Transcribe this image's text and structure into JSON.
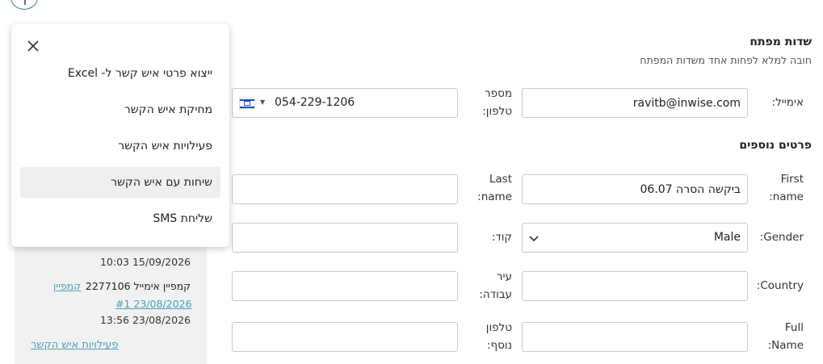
{
  "menu": {
    "items": [
      {
        "label": "ייצוא פרטי איש קשר ל- Excel"
      },
      {
        "label": "מחיקת איש הקשר"
      },
      {
        "label": "פעילויות איש הקשר"
      },
      {
        "label": "שיחות עם איש הקשר"
      },
      {
        "label": "שליחת SMS"
      }
    ]
  },
  "activity": {
    "items": [
      {
        "date": "10:03 15/09/2026"
      },
      {
        "text": "קמפיין אימייל 2277106",
        "link": "קמפיין #1 23/08/2026",
        "date": "13:56 23/08/2026"
      }
    ],
    "footer_link": "פעילויות איש הקשר"
  },
  "key_fields": {
    "title": "שדות מפתח",
    "subtitle": "חובה למלא לפחות אחד משדות המפתח",
    "email_label": "אימייל:",
    "email_value": "ravitb@inwise.com",
    "phone_label": "מספר טלפון:",
    "phone_value": "054-229-1206"
  },
  "extra_fields": {
    "title": "פרטים נוספים",
    "first_name_label": "First name:",
    "first_name_value": "ביקשה הסרה 06.07",
    "last_name_label": "Last name:",
    "last_name_value": "",
    "gender_label": "Gender:",
    "gender_value": "Male",
    "code_label": "קוד:",
    "code_value": "",
    "country_label": "Country:",
    "country_value": "",
    "work_city_label": "עיר עבודה:",
    "work_city_value": "",
    "full_name_label": "Full Name:",
    "full_name_value": "",
    "extra_phone_label": "טלפון נוסף:",
    "extra_phone_value": ""
  }
}
